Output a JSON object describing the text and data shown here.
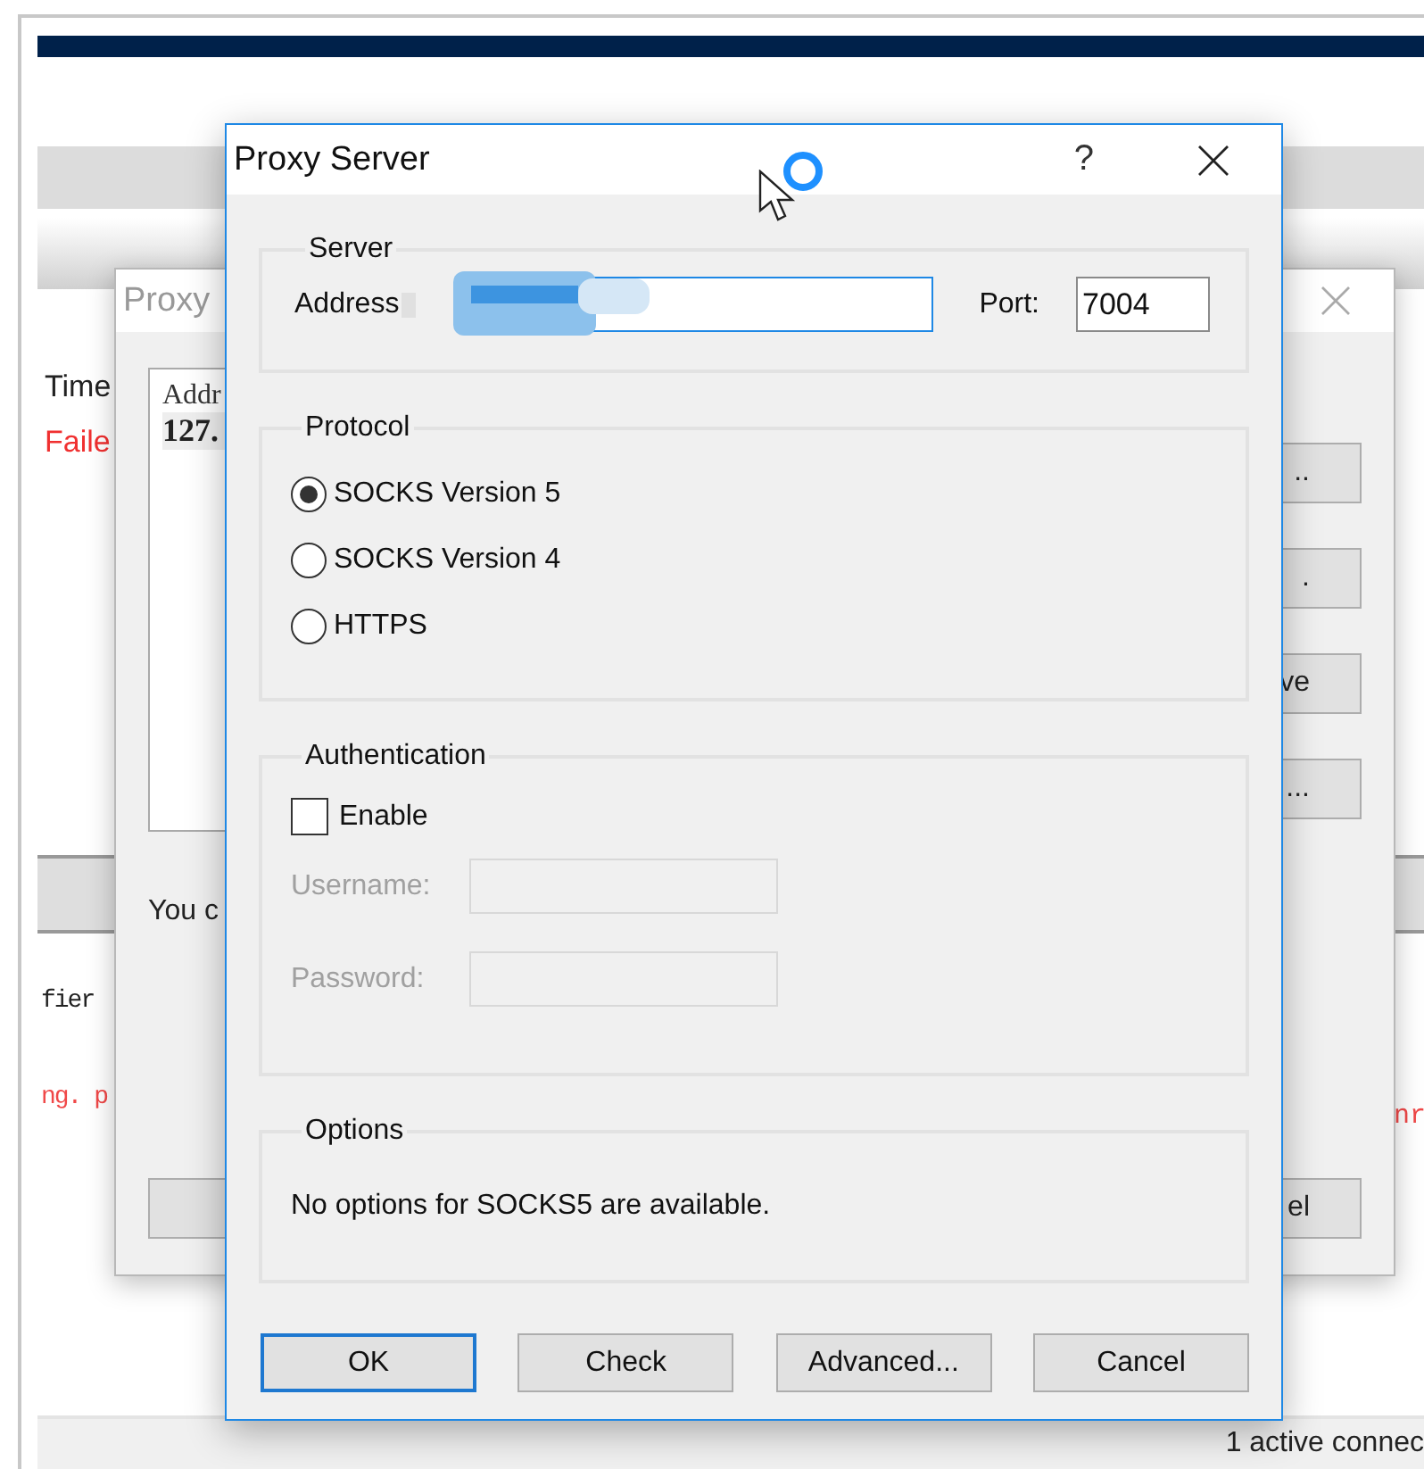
{
  "page": {
    "labels": [
      {
        "text": "Time",
        "kind": "normal"
      },
      {
        "text": "Faile",
        "kind": "error"
      }
    ],
    "log_lines": [
      {
        "text": "fier",
        "kind": "normal"
      },
      {
        "text": "ng. p",
        "kind": "error"
      }
    ],
    "right_fragment": "nr",
    "status_bar": "1 active connec"
  },
  "back_dialog": {
    "title": "Proxy",
    "list_header": "Addr",
    "list_item": "127.",
    "message": "You c",
    "side_buttons": [
      "..",
      ".",
      "ve",
      "..."
    ],
    "cancel_fragment": "el"
  },
  "dialog": {
    "title": "Proxy Server",
    "help": "?",
    "server": {
      "legend": "Server",
      "address_label": "Address",
      "port_label": "Port:",
      "port_value": "7004"
    },
    "protocol": {
      "legend": "Protocol",
      "options": [
        {
          "label": "SOCKS Version 5",
          "selected": true
        },
        {
          "label": "SOCKS Version 4",
          "selected": false
        },
        {
          "label": "HTTPS",
          "selected": false
        }
      ]
    },
    "authentication": {
      "legend": "Authentication",
      "enable": {
        "label": "Enable",
        "checked": false
      },
      "fields": [
        {
          "label": "Username:",
          "disabled": true
        },
        {
          "label": "Password:",
          "disabled": true
        }
      ]
    },
    "options": {
      "legend": "Options",
      "message": "No options for SOCKS5 are available."
    },
    "buttons": [
      {
        "label": "OK",
        "default": true
      },
      {
        "label": "Check",
        "default": false
      },
      {
        "label": "Advanced...",
        "default": false
      },
      {
        "label": "Cancel",
        "default": false
      }
    ]
  }
}
